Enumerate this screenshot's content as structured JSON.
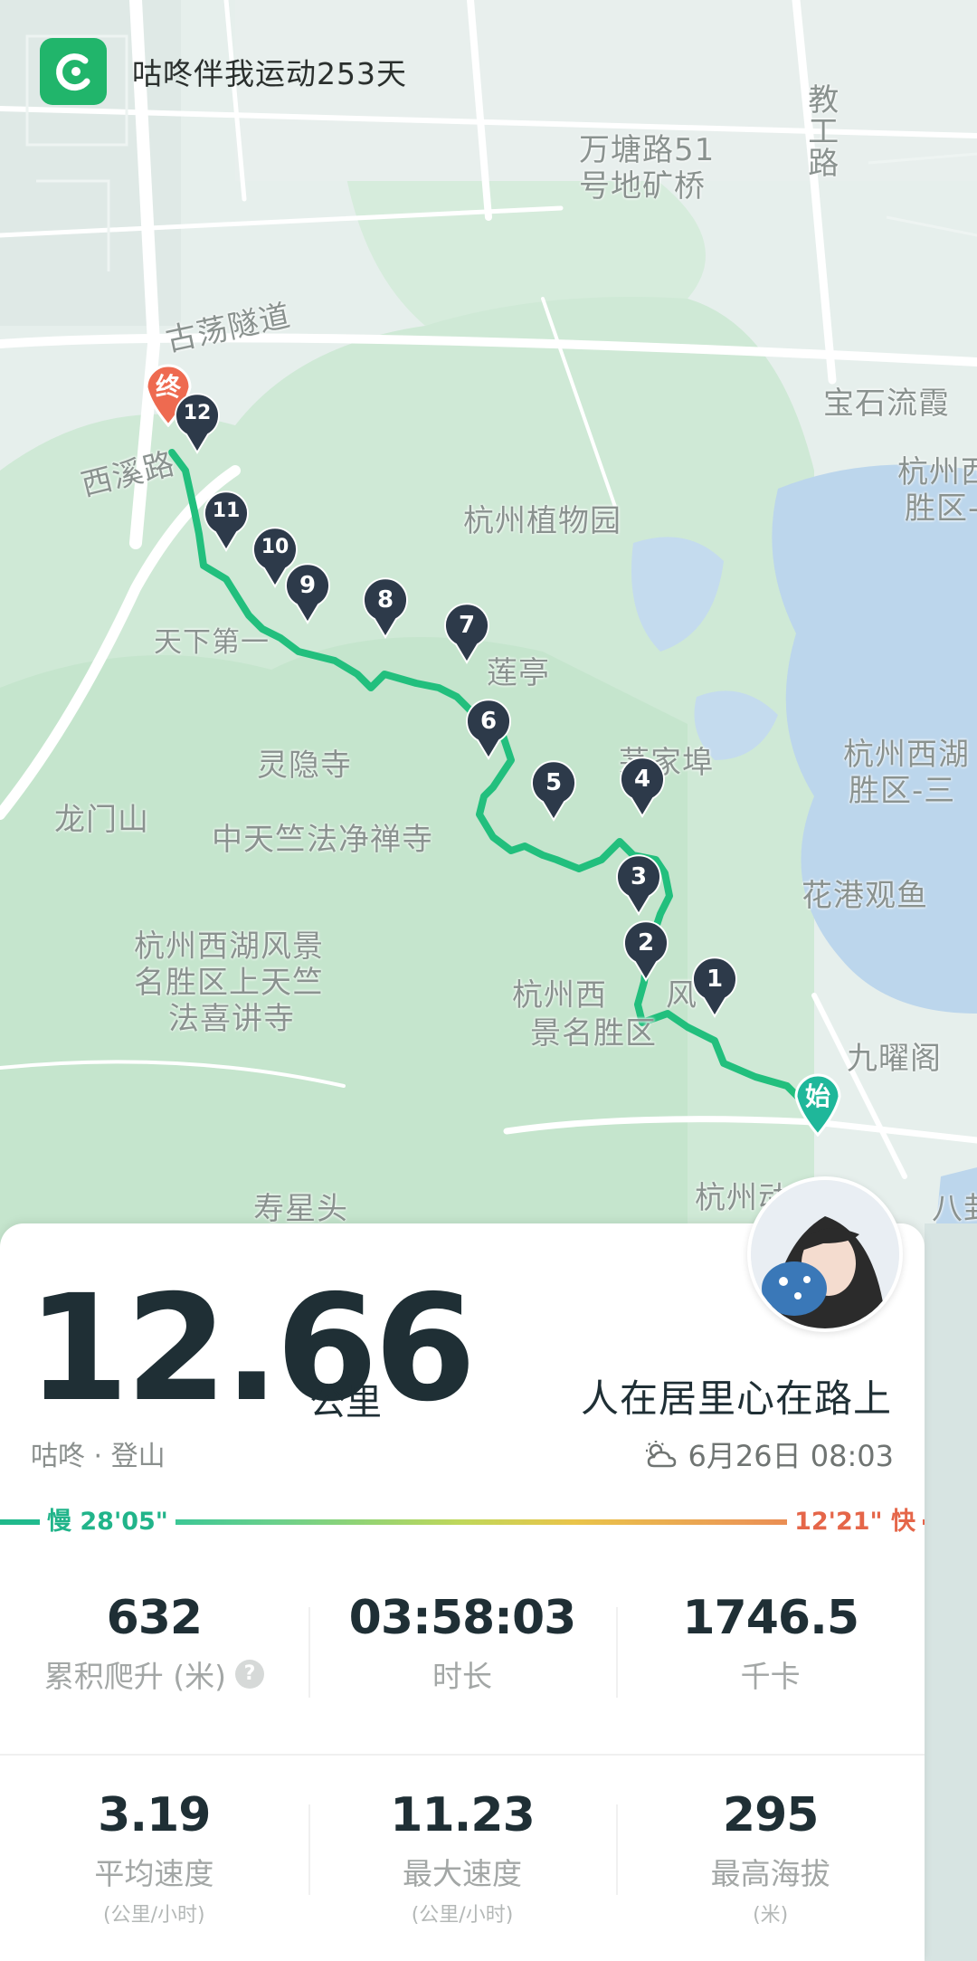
{
  "app": {
    "title": "咕咚伴我运动253天",
    "accent": "#21b56b"
  },
  "map": {
    "labels": {
      "jiaogonglu": "教工路",
      "wantang": "万塘路51",
      "wantang2": "号地矿桥",
      "gudang": "古荡隧道",
      "baoshi": "宝石流霞",
      "hangzhou_xi": "杭州西",
      "hangzhou_xi2": "胜区-",
      "xixi": "西溪路",
      "zhiwuyuan": "杭州植物园",
      "tianxia": "天下第一",
      "lianting": "莲亭",
      "lingyin": "灵隐寺",
      "maojiabu": "茅家埠",
      "westlake": "杭州西湖",
      "westlake2": "胜区-三",
      "longmen": "龙门山",
      "zhongtianzhu": "中天竺法净禅寺",
      "huagang": "花港观鱼",
      "shangtianzhu1": "杭州西湖风景",
      "shangtianzhu2": "名胜区上天竺",
      "shangtianzhu3": "法喜讲寺",
      "scenic1": "杭州西",
      "scenic1b": "风",
      "scenic2": "景名胜区",
      "jiuyao": "九曜阁",
      "shouxing": "寿星头",
      "hangzhou_bottom": "杭州动",
      "ba": "八卦"
    },
    "start_label": "始",
    "end_label": "终",
    "markers": [
      "1",
      "2",
      "3",
      "4",
      "5",
      "6",
      "7",
      "8",
      "9",
      "10",
      "11",
      "12"
    ]
  },
  "summary": {
    "distance": "12.66",
    "distance_unit": "公里",
    "activity": "咕咚 · 登山",
    "slogan": "人在居里心在路上",
    "datetime": "6月26日 08:03"
  },
  "pace": {
    "slow_label": "慢 28'05\"",
    "fast_label": "12'21\" 快",
    "slow_color": "#21b48a",
    "fast_color": "#e56649"
  },
  "stats": {
    "row1": [
      {
        "value": "632",
        "label": "累积爬升 (米)"
      },
      {
        "value": "03:58:03",
        "label": "时长"
      },
      {
        "value": "1746.5",
        "label": "千卡"
      }
    ],
    "row2": [
      {
        "value": "3.19",
        "label": "平均速度",
        "unit": "(公里/小时)"
      },
      {
        "value": "11.23",
        "label": "最大速度",
        "unit": "(公里/小时)"
      },
      {
        "value": "295",
        "label": "最高海拔",
        "unit": "(米)"
      }
    ]
  }
}
